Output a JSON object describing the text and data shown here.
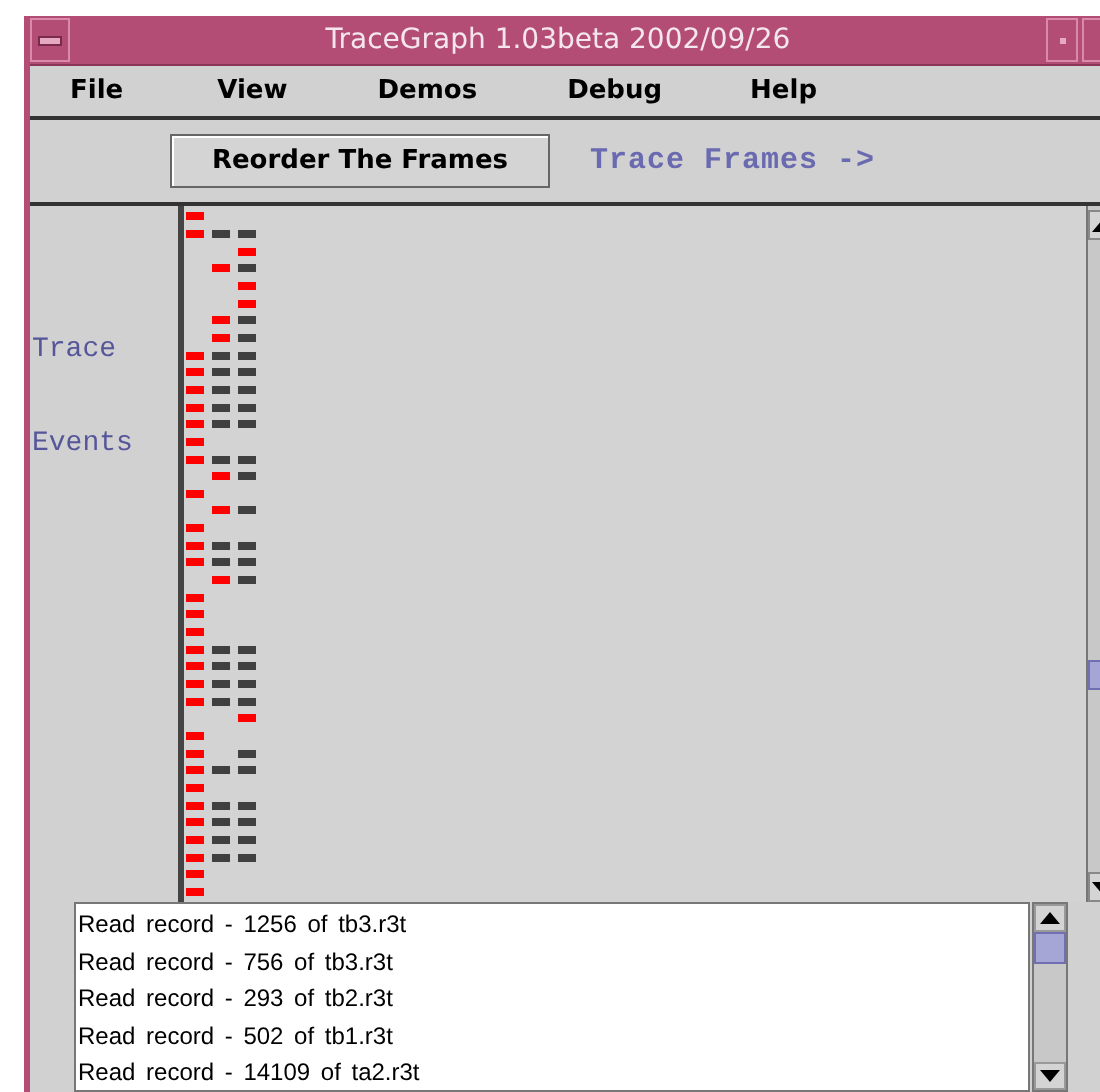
{
  "window": {
    "title": "TraceGraph 1.03beta 2002/09/26"
  },
  "menu": [
    "File",
    "View",
    "Demos",
    "Debug",
    "Help"
  ],
  "toolbar": {
    "button": "Reorder The Frames",
    "frames_label": "Trace Frames ->"
  },
  "side_labels": [
    "Trace",
    "Events"
  ],
  "trace_rows": [
    {
      "cells": [
        {
          "color": "#ff0000"
        },
        null,
        null
      ]
    },
    {
      "cells": [
        {
          "color": "#ff0000"
        },
        {
          "color": "#404040"
        },
        {
          "color": "#404040"
        }
      ]
    },
    {
      "cells": [
        null,
        null,
        {
          "color": "#ff0000"
        }
      ]
    },
    {
      "cells": [
        null,
        {
          "color": "#ff0000"
        },
        {
          "color": "#404040"
        }
      ]
    },
    {
      "cells": [
        null,
        null,
        {
          "color": "#ff0000"
        }
      ]
    },
    {
      "cells": [
        null,
        null,
        {
          "color": "#ff0000"
        }
      ]
    },
    {
      "cells": [
        null,
        {
          "color": "#ff0000"
        },
        {
          "color": "#404040"
        }
      ]
    },
    {
      "cells": [
        null,
        {
          "color": "#ff0000"
        },
        {
          "color": "#404040"
        }
      ]
    },
    {
      "cells": [
        {
          "color": "#ff0000"
        },
        {
          "color": "#404040"
        },
        {
          "color": "#404040"
        }
      ]
    },
    {
      "cells": [
        {
          "color": "#ff0000"
        },
        {
          "color": "#404040"
        },
        {
          "color": "#404040"
        }
      ]
    },
    {
      "cells": [
        {
          "color": "#ff0000"
        },
        {
          "color": "#404040"
        },
        {
          "color": "#404040"
        }
      ]
    },
    {
      "cells": [
        {
          "color": "#ff0000"
        },
        {
          "color": "#404040"
        },
        {
          "color": "#404040"
        }
      ]
    },
    {
      "cells": [
        {
          "color": "#ff0000"
        },
        {
          "color": "#404040"
        },
        {
          "color": "#404040"
        }
      ]
    },
    {
      "cells": [
        {
          "color": "#ff0000"
        },
        null,
        null
      ]
    },
    {
      "cells": [
        {
          "color": "#ff0000"
        },
        {
          "color": "#404040"
        },
        {
          "color": "#404040"
        }
      ]
    },
    {
      "cells": [
        null,
        {
          "color": "#ff0000"
        },
        {
          "color": "#404040"
        }
      ]
    },
    {
      "cells": [
        {
          "color": "#ff0000"
        },
        null,
        null
      ]
    },
    {
      "cells": [
        null,
        {
          "color": "#ff0000"
        },
        {
          "color": "#404040"
        }
      ]
    },
    {
      "cells": [
        {
          "color": "#ff0000"
        },
        null,
        null
      ]
    },
    {
      "cells": [
        {
          "color": "#ff0000"
        },
        {
          "color": "#404040"
        },
        {
          "color": "#404040"
        }
      ]
    },
    {
      "cells": [
        {
          "color": "#ff0000"
        },
        {
          "color": "#404040"
        },
        {
          "color": "#404040"
        }
      ]
    },
    {
      "cells": [
        null,
        {
          "color": "#ff0000"
        },
        {
          "color": "#404040"
        }
      ]
    },
    {
      "cells": [
        {
          "color": "#ff0000"
        },
        null,
        null
      ]
    },
    {
      "cells": [
        {
          "color": "#ff0000"
        },
        null,
        null
      ]
    },
    {
      "cells": [
        {
          "color": "#ff0000"
        },
        null,
        null
      ]
    },
    {
      "cells": [
        {
          "color": "#ff0000"
        },
        {
          "color": "#404040"
        },
        {
          "color": "#404040"
        }
      ]
    },
    {
      "cells": [
        {
          "color": "#ff0000"
        },
        {
          "color": "#404040"
        },
        {
          "color": "#404040"
        }
      ]
    },
    {
      "cells": [
        {
          "color": "#ff0000"
        },
        {
          "color": "#404040"
        },
        {
          "color": "#404040"
        }
      ]
    },
    {
      "cells": [
        {
          "color": "#ff0000"
        },
        {
          "color": "#404040"
        },
        {
          "color": "#404040"
        }
      ]
    },
    {
      "cells": [
        null,
        null,
        {
          "color": "#ff0000"
        }
      ]
    },
    {
      "cells": [
        {
          "color": "#ff0000"
        },
        null,
        null
      ]
    },
    {
      "cells": [
        {
          "color": "#ff0000"
        },
        null,
        {
          "color": "#404040"
        }
      ]
    },
    {
      "cells": [
        {
          "color": "#ff0000"
        },
        {
          "color": "#404040"
        },
        {
          "color": "#404040"
        }
      ]
    },
    {
      "cells": [
        {
          "color": "#ff0000"
        },
        null,
        null
      ]
    },
    {
      "cells": [
        {
          "color": "#ff0000"
        },
        {
          "color": "#404040"
        },
        {
          "color": "#404040"
        }
      ]
    },
    {
      "cells": [
        {
          "color": "#ff0000"
        },
        {
          "color": "#404040"
        },
        {
          "color": "#404040"
        }
      ]
    },
    {
      "cells": [
        {
          "color": "#ff0000"
        },
        {
          "color": "#404040"
        },
        {
          "color": "#404040"
        }
      ]
    },
    {
      "cells": [
        {
          "color": "#ff0000"
        },
        {
          "color": "#404040"
        },
        {
          "color": "#404040"
        }
      ]
    },
    {
      "cells": [
        {
          "color": "#ff0000"
        },
        null,
        null
      ]
    },
    {
      "cells": [
        {
          "color": "#ff0000"
        },
        null,
        null
      ]
    }
  ],
  "log": [
    "Read record - 1256 of tb3.r3t",
    "Read record - 756 of tb3.r3t",
    "Read record - 293 of tb2.r3t",
    "Read record - 502 of tb1.r3t",
    "Read record - 14109 of ta2.r3t"
  ]
}
